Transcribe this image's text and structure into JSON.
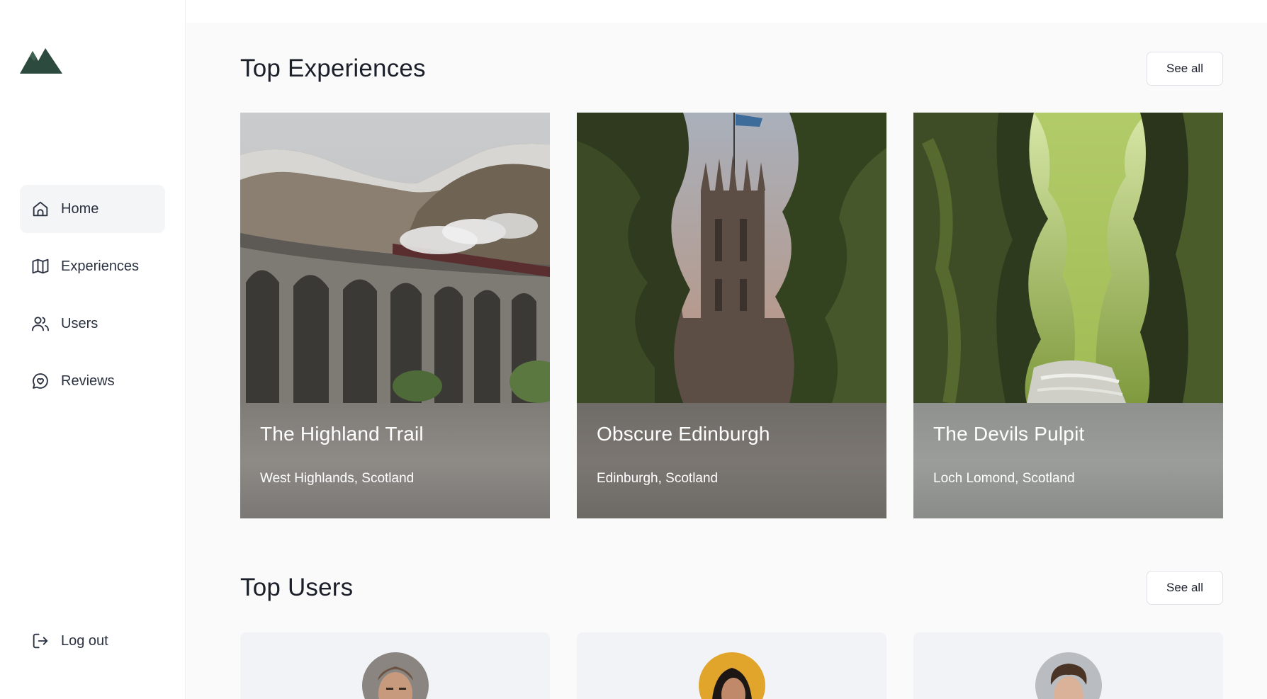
{
  "sidebar": {
    "logo_icon": "mountain-logo-icon",
    "items": [
      {
        "label": "Home",
        "icon": "home-icon",
        "active": true
      },
      {
        "label": "Experiences",
        "icon": "map-icon",
        "active": false
      },
      {
        "label": "Users",
        "icon": "users-icon",
        "active": false
      },
      {
        "label": "Reviews",
        "icon": "chat-heart-icon",
        "active": false
      }
    ],
    "logout": {
      "label": "Log out",
      "icon": "logout-icon"
    }
  },
  "top_experiences": {
    "title": "Top Experiences",
    "see_all": "See all",
    "cards": [
      {
        "title": "The Highland Trail",
        "location": "West Highlands, Scotland"
      },
      {
        "title": "Obscure Edinburgh",
        "location": "Edinburgh, Scotland"
      },
      {
        "title": "The Devils Pulpit",
        "location": "Loch Lomond, Scotland"
      }
    ]
  },
  "top_users": {
    "title": "Top Users",
    "see_all": "See all"
  },
  "colors": {
    "logo": "#2d4a3e",
    "active_nav_bg": "#f4f5f7",
    "main_bg": "#fafafa"
  }
}
